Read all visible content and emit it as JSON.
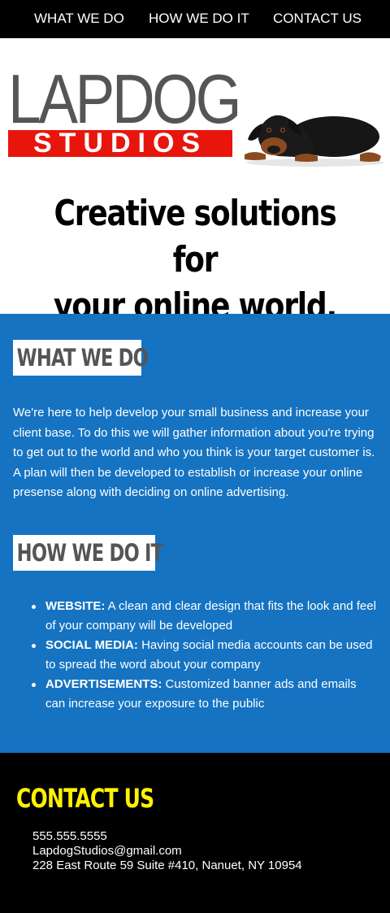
{
  "nav": {
    "items": [
      {
        "label": "WHAT WE DO"
      },
      {
        "label": "HOW WE DO IT"
      },
      {
        "label": "CONTACT US"
      }
    ]
  },
  "logo": {
    "top_text": "LAPDOG",
    "bottom_text": "STUDIOS",
    "accent_color": "#e8150c"
  },
  "hero": {
    "tagline_line1": "Creative solutions for",
    "tagline_line2": "your online world."
  },
  "what_we_do": {
    "heading": "WHAT WE DO",
    "body": "We're here to help develop your small business and increase your client base. To do this we will gather information about you're trying to get out to the world and who you think is your target customer is. A plan will then be developed to establish or increase your online presense along with deciding on online advertising."
  },
  "how_we_do_it": {
    "heading": "HOW WE DO IT",
    "items": [
      {
        "title": "WEBSITE:",
        "text": " A clean and clear design that fits the look and feel of your company will be developed"
      },
      {
        "title": "SOCIAL MEDIA:",
        "text": " Having social media accounts can be used to spread the word about your company"
      },
      {
        "title": "ADVERTISEMENTS:",
        "text": " Customized banner ads and emails can increase your exposure to the public"
      }
    ]
  },
  "contact": {
    "heading": "CONTACT US",
    "phone": "555.555.5555",
    "email": "LapdogStudios@gmail.com",
    "address": "228 East Route 59 Suite #410, Nanuet, NY 10954",
    "heading_color": "#fff200"
  },
  "colors": {
    "section_blue": "#1573c2",
    "nav_bg": "#000000"
  }
}
